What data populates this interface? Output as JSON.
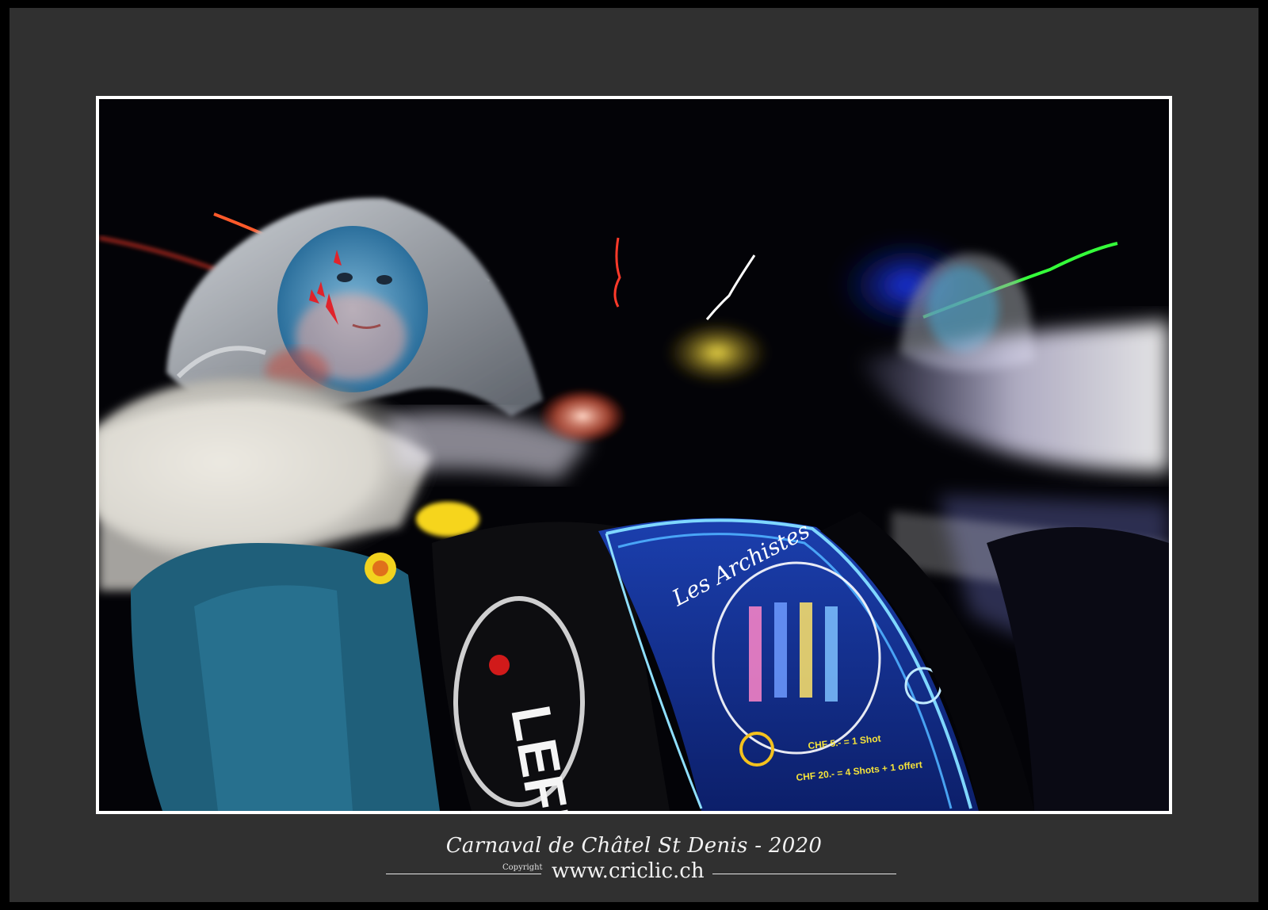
{
  "frame": {
    "mat_color": "#303030",
    "border_color": "#ffffff"
  },
  "photo": {
    "subject": "carnival-night-parade-motion-blur",
    "drum_text_top": "Les Archistes",
    "drum_price_1": "CHF 5.- = 1 Shot",
    "drum_price_2": "CHF 20.- = 4 Shots + 1 offert",
    "drum_logo_text": "LEFIN"
  },
  "caption": {
    "title": "Carnaval de Châtel St Denis - 2020",
    "copyright_label": "Copyright",
    "website": "www.criclic.ch"
  }
}
